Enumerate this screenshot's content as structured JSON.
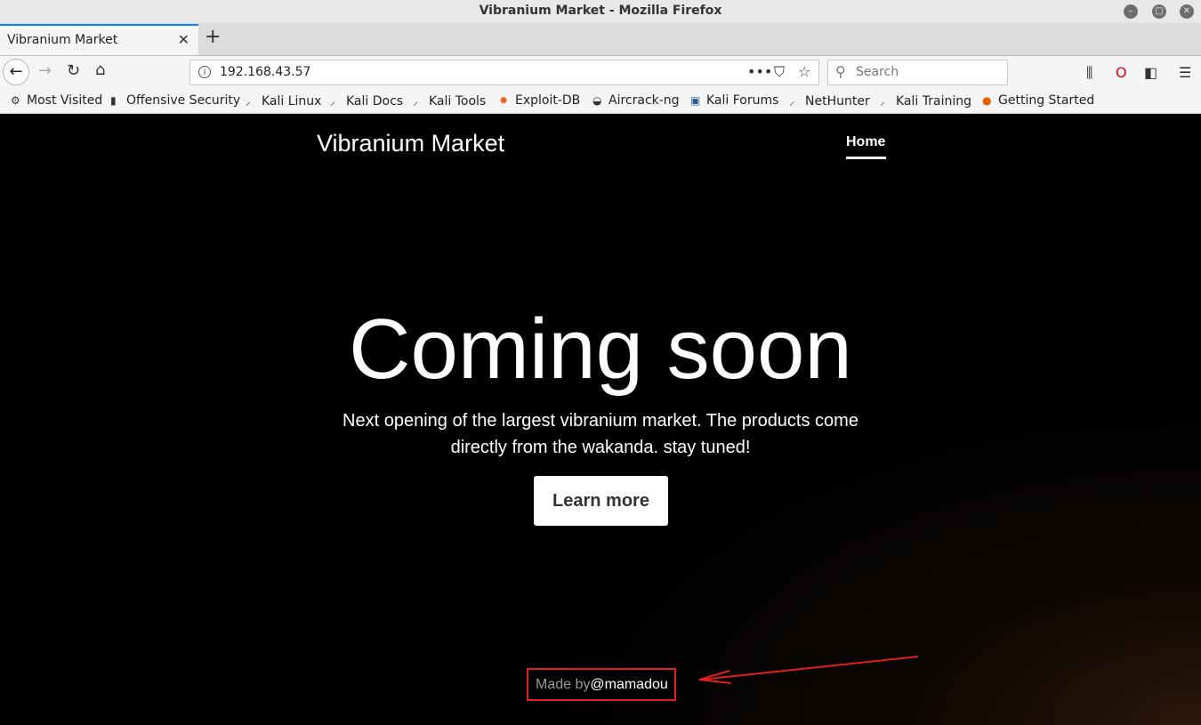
{
  "window": {
    "title": "Vibranium Market - Mozilla Firefox"
  },
  "tabs": [
    {
      "title": "Vibranium Market",
      "active": true
    }
  ],
  "url": {
    "value": "192.168.43.57"
  },
  "search": {
    "placeholder": "Search"
  },
  "bookmarks": [
    {
      "label": "Most Visited",
      "icon": "gear-icon"
    },
    {
      "label": "Offensive Security",
      "icon": "offsec-icon"
    },
    {
      "label": "Kali Linux",
      "icon": "kali-icon"
    },
    {
      "label": "Kali Docs",
      "icon": "kali-icon"
    },
    {
      "label": "Kali Tools",
      "icon": "kali-icon"
    },
    {
      "label": "Exploit-DB",
      "icon": "exploit-db-icon"
    },
    {
      "label": "Aircrack-ng",
      "icon": "aircrack-icon"
    },
    {
      "label": "Kali Forums",
      "icon": "kali-forums-icon"
    },
    {
      "label": "NetHunter",
      "icon": "kali-icon"
    },
    {
      "label": "Kali Training",
      "icon": "kali-icon"
    },
    {
      "label": "Getting Started",
      "icon": "firefox-icon"
    }
  ],
  "site": {
    "brand": "Vibranium Market",
    "nav_home": "Home",
    "headline": "Coming soon",
    "lead": "Next opening of the largest vibranium market. The products come directly from the wakanda. stay tuned!",
    "cta": "Learn more",
    "footer_made_by": "Made by",
    "footer_author": "@mamadou"
  },
  "annotation": {
    "box_color": "#e02020"
  }
}
